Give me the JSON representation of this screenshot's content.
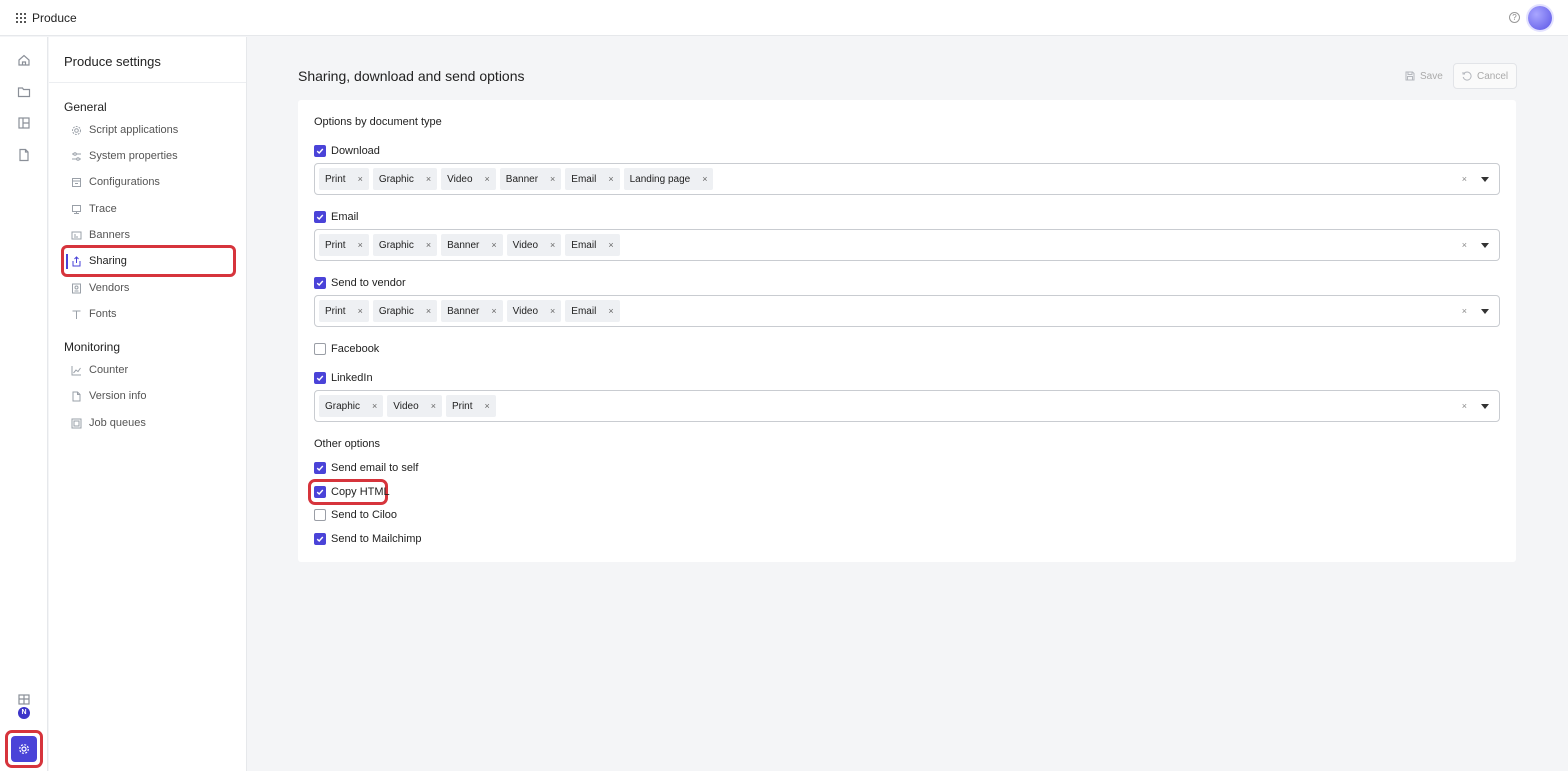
{
  "topbar": {
    "app_name": "Produce",
    "help_icon": "question-circle-icon"
  },
  "rail": {
    "user_badge": "N"
  },
  "settings_nav": {
    "title": "Produce settings",
    "sections": [
      {
        "label": "General",
        "items": [
          {
            "label": "Script applications",
            "icon": "gear-icon"
          },
          {
            "label": "System properties",
            "icon": "sliders-icon"
          },
          {
            "label": "Configurations",
            "icon": "config-icon"
          },
          {
            "label": "Trace",
            "icon": "monitor-icon"
          },
          {
            "label": "Banners",
            "icon": "banner-icon"
          },
          {
            "label": "Sharing",
            "icon": "share-icon",
            "active": true
          },
          {
            "label": "Vendors",
            "icon": "vendor-icon"
          },
          {
            "label": "Fonts",
            "icon": "font-icon"
          }
        ]
      },
      {
        "label": "Monitoring",
        "items": [
          {
            "label": "Counter",
            "icon": "chart-line-icon"
          },
          {
            "label": "Version info",
            "icon": "document-icon"
          },
          {
            "label": "Job queues",
            "icon": "queue-icon"
          }
        ]
      }
    ]
  },
  "main": {
    "title": "Sharing, download and send options",
    "save_label": "Save",
    "cancel_label": "Cancel",
    "options_by_type_label": "Options by document type",
    "doc_options": [
      {
        "label": "Download",
        "checked": true,
        "tags": [
          "Print",
          "Graphic",
          "Video",
          "Banner",
          "Email",
          "Landing page"
        ]
      },
      {
        "label": "Email",
        "checked": true,
        "tags": [
          "Print",
          "Graphic",
          "Banner",
          "Video",
          "Email"
        ]
      },
      {
        "label": "Send to vendor",
        "checked": true,
        "tags": [
          "Print",
          "Graphic",
          "Banner",
          "Video",
          "Email"
        ]
      },
      {
        "label": "Facebook",
        "checked": false,
        "tags": []
      },
      {
        "label": "LinkedIn",
        "checked": true,
        "tags": [
          "Graphic",
          "Video",
          "Print"
        ]
      }
    ],
    "other_options_label": "Other options",
    "other_options": [
      {
        "label": "Send email to self",
        "checked": true
      },
      {
        "label": "Copy HTML",
        "checked": true
      },
      {
        "label": "Send to Ciloo",
        "checked": false
      },
      {
        "label": "Send to Mailchimp",
        "checked": true
      }
    ],
    "chip_remove_glyph": "×",
    "clear_glyph": "×"
  },
  "colors": {
    "accent": "#4a43d8",
    "highlight": "#d6343c"
  }
}
